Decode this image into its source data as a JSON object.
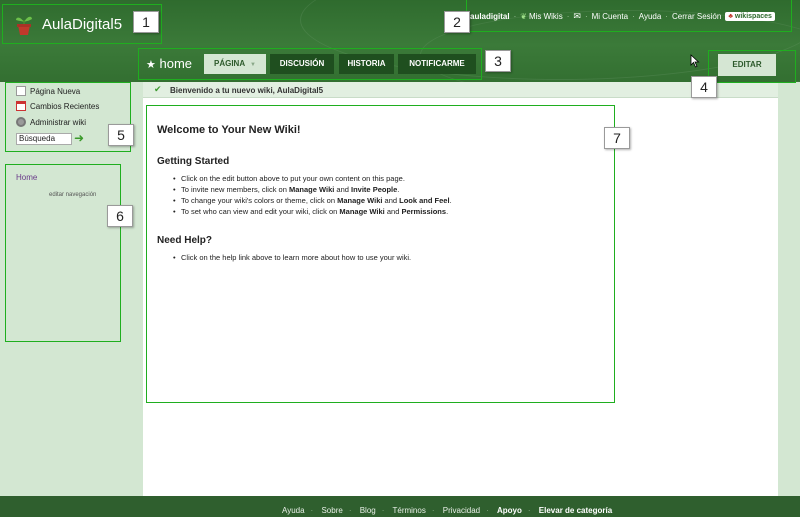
{
  "header": {
    "site_title": "AulaDigital5",
    "user": "auladigital",
    "links": [
      "Mis Wikis",
      "Mi Cuenta",
      "Ayuda",
      "Cerrar Sesión"
    ],
    "badge": "wikispaces"
  },
  "page": {
    "name": "home",
    "tabs": [
      "PÁGINA",
      "DISCUSIÓN",
      "HISTORIA",
      "NOTIFICARME"
    ],
    "edit_label": "EDITAR",
    "welcome": "Bienvenido a tu nuevo wiki, AulaDigital5"
  },
  "sidebar": {
    "actions": [
      "Página Nueva",
      "Cambios Recientes",
      "Administrar wiki"
    ],
    "search_value": "Búsqueda",
    "nav_home": "Home",
    "nav_edit": "editar navegación"
  },
  "content": {
    "title": "Welcome to Your New Wiki!",
    "section1_title": "Getting Started",
    "s1_item1": "Click on the edit button above to put your own content on this page.",
    "s1_item2_a": "To invite new members, click on ",
    "s1_item2_b": "Manage Wiki",
    "s1_item2_c": " and ",
    "s1_item2_d": "Invite People",
    "s1_item2_e": ".",
    "s1_item3_a": "To change your wiki's colors or theme, click on ",
    "s1_item3_b": "Manage Wiki",
    "s1_item3_c": " and ",
    "s1_item3_d": "Look and Feel",
    "s1_item3_e": ".",
    "s1_item4_a": "To set who can view and edit your wiki, click on ",
    "s1_item4_b": "Manage Wiki",
    "s1_item4_c": " and ",
    "s1_item4_d": "Permissions",
    "s1_item4_e": ".",
    "section2_title": "Need Help?",
    "s2_item1": "Click on the help link above to learn more about how to use your wiki."
  },
  "footer": {
    "links": [
      "Ayuda",
      "Sobre",
      "Blog",
      "Términos",
      "Privacidad",
      "Apoyo",
      "Elevar de categoría"
    ]
  },
  "callouts": [
    "1",
    "2",
    "3",
    "4",
    "5",
    "6",
    "7"
  ],
  "colors": {
    "header_green": "#3b7a39",
    "sidebar_bg": "#d3e7d2",
    "callout_green": "#1fae1f",
    "tab_dark": "#1f4f1f"
  }
}
